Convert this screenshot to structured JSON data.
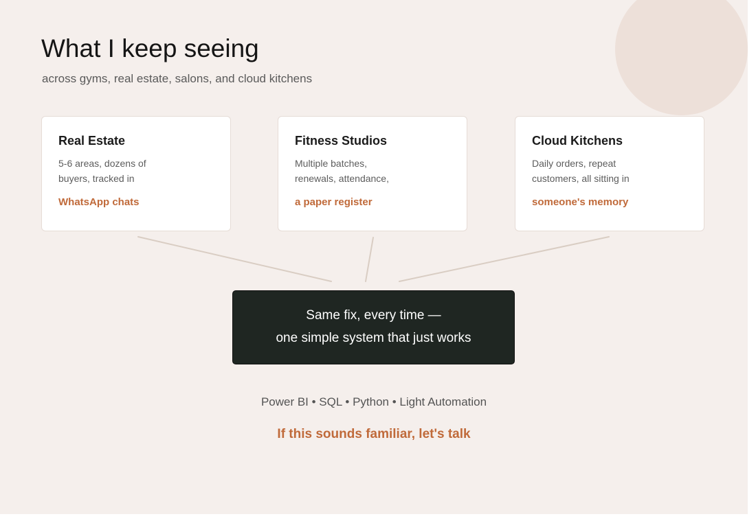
{
  "header": {
    "title": "What I keep seeing",
    "subtitle": "across gyms, real estate, salons, and cloud kitchens"
  },
  "cards": [
    {
      "title": "Real Estate",
      "desc_line1": "5-6 areas, dozens of",
      "desc_line2": "buyers, tracked in",
      "highlight": "WhatsApp chats"
    },
    {
      "title": "Fitness Studios",
      "desc_line1": "Multiple batches,",
      "desc_line2": "renewals, attendance,",
      "highlight": "a paper register"
    },
    {
      "title": "Cloud Kitchens",
      "desc_line1": "Daily orders, repeat",
      "desc_line2": "customers, all sitting in",
      "highlight": "someone's memory"
    }
  ],
  "solution": {
    "line1": "Same fix, every time —",
    "line2": "one simple system that just works"
  },
  "tools": "Power BI • SQL • Python • Light Automation",
  "cta": "If this sounds familiar, let's talk",
  "colors": {
    "background": "#f5efec",
    "accent": "#c06a3a",
    "dark_box": "#1f2622",
    "connector": "#d9cdc3"
  }
}
